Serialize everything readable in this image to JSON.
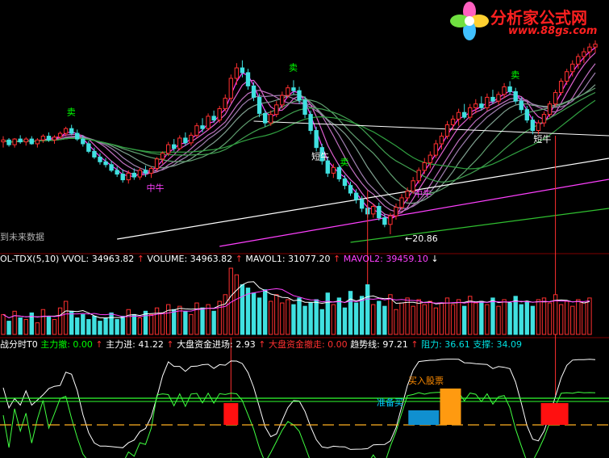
{
  "logo": {
    "name": "分析家公式网",
    "url": "www.88gs.com"
  },
  "price_panel": {
    "side_label": "到未来数据",
    "signals": [
      {
        "text": "卖",
        "color": "#00ff00"
      },
      {
        "text": "卖",
        "color": "#00ff00"
      },
      {
        "text": "卖",
        "color": "#00ff00"
      },
      {
        "text": "卖",
        "color": "#00ff00"
      },
      {
        "text": "短牛",
        "color": "#ffffff"
      },
      {
        "text": "短牛",
        "color": "#ffffff"
      },
      {
        "text": "中牛",
        "color": "#ff40ff"
      },
      {
        "text": "中牛",
        "color": "#ff40ff"
      }
    ],
    "low_marker": "←20.86"
  },
  "volume_panel": {
    "header": [
      {
        "text": "OL-TDX(5,10)",
        "color": "#ffffff"
      },
      {
        "text": "VVOL: 34963.82",
        "color": "#ffffff"
      },
      {
        "text": "↑",
        "color": "#ff3030"
      },
      {
        "text": "VOLUME: 34963.82",
        "color": "#ffffff"
      },
      {
        "text": "↑",
        "color": "#ff3030"
      },
      {
        "text": "MAVOL1: 31077.20",
        "color": "#ffffff"
      },
      {
        "text": "↑",
        "color": "#ff3030"
      },
      {
        "text": "MAVOL2: 39459.10",
        "color": "#ff40ff"
      },
      {
        "text": "↓",
        "color": "#ffffff"
      }
    ]
  },
  "indicator_panel": {
    "header": [
      {
        "text": "战分时T0",
        "color": "#ffffff"
      },
      {
        "text": "主力撤: 0.00",
        "color": "#00ff00"
      },
      {
        "text": "↑",
        "color": "#ff3030"
      },
      {
        "text": "主力进: 41.22",
        "color": "#ffffff"
      },
      {
        "text": "↑",
        "color": "#ff3030"
      },
      {
        "text": "大盘资金进场: 2.93",
        "color": "#ffffff"
      },
      {
        "text": "↑",
        "color": "#ff3030"
      },
      {
        "text": "大盘资金撤走: 0.00",
        "color": "#ff3030"
      },
      {
        "text": "趋势线: 97.21",
        "color": "#ffffff"
      },
      {
        "text": "↑",
        "color": "#ff3030"
      },
      {
        "text": "阻力: 36.61",
        "color": "#00e0e0"
      },
      {
        "text": "支撑: 34.09",
        "color": "#00e0e0"
      }
    ],
    "buy_label": "买入股票",
    "ready_label": "准备买"
  },
  "chart_data": {
    "type": "candlestick",
    "candles": [
      [
        30.6,
        31.2,
        30.0,
        30.8
      ],
      [
        30.8,
        31.0,
        30.1,
        30.3
      ],
      [
        30.3,
        31.0,
        30.0,
        30.9
      ],
      [
        30.9,
        31.3,
        30.4,
        30.6
      ],
      [
        30.6,
        31.1,
        30.2,
        30.9
      ],
      [
        30.9,
        31.2,
        30.3,
        30.4
      ],
      [
        30.4,
        31.0,
        30.0,
        30.8
      ],
      [
        30.8,
        31.4,
        30.5,
        31.2
      ],
      [
        31.2,
        31.6,
        30.6,
        30.8
      ],
      [
        30.8,
        31.3,
        30.4,
        31.1
      ],
      [
        31.1,
        31.7,
        30.9,
        31.5
      ],
      [
        31.5,
        32.2,
        31.2,
        32.0
      ],
      [
        32.0,
        32.4,
        31.3,
        31.5
      ],
      [
        31.5,
        31.9,
        30.7,
        30.9
      ],
      [
        30.9,
        31.3,
        30.1,
        30.4
      ],
      [
        30.4,
        30.7,
        29.4,
        29.6
      ],
      [
        29.6,
        30.0,
        28.8,
        29.0
      ],
      [
        29.0,
        29.4,
        28.2,
        28.5
      ],
      [
        28.5,
        28.9,
        27.9,
        28.2
      ],
      [
        28.2,
        28.6,
        27.4,
        27.6
      ],
      [
        27.6,
        28.0,
        26.9,
        27.2
      ],
      [
        27.2,
        27.7,
        26.3,
        26.6
      ],
      [
        26.6,
        27.6,
        26.2,
        27.3
      ],
      [
        27.3,
        27.8,
        26.6,
        26.9
      ],
      [
        26.9,
        27.9,
        26.6,
        27.6
      ],
      [
        27.6,
        28.1,
        26.9,
        27.3
      ],
      [
        27.3,
        28.0,
        26.8,
        27.8
      ],
      [
        27.8,
        29.0,
        27.5,
        28.8
      ],
      [
        28.8,
        29.6,
        28.3,
        29.4
      ],
      [
        29.4,
        30.6,
        29.1,
        30.3
      ],
      [
        30.3,
        30.9,
        29.6,
        29.9
      ],
      [
        29.9,
        31.3,
        29.7,
        31.0
      ],
      [
        31.0,
        31.6,
        30.2,
        30.5
      ],
      [
        30.5,
        31.6,
        30.2,
        31.3
      ],
      [
        31.3,
        32.6,
        31.0,
        32.3
      ],
      [
        32.3,
        33.1,
        31.6,
        32.0
      ],
      [
        32.0,
        33.6,
        31.8,
        33.3
      ],
      [
        33.3,
        33.9,
        32.6,
        32.9
      ],
      [
        32.9,
        34.4,
        32.6,
        34.1
      ],
      [
        34.1,
        35.6,
        33.8,
        35.2
      ],
      [
        35.2,
        37.7,
        34.7,
        37.3
      ],
      [
        37.3,
        38.9,
        36.6,
        38.4
      ],
      [
        38.4,
        39.2,
        37.4,
        37.9
      ],
      [
        37.9,
        38.3,
        36.1,
        36.5
      ],
      [
        36.5,
        36.9,
        34.9,
        35.3
      ],
      [
        35.3,
        35.7,
        33.2,
        33.6
      ],
      [
        33.6,
        34.0,
        32.2,
        32.6
      ],
      [
        32.6,
        33.9,
        32.3,
        33.5
      ],
      [
        33.5,
        34.9,
        33.2,
        34.5
      ],
      [
        34.5,
        35.9,
        34.1,
        35.5
      ],
      [
        35.5,
        36.6,
        35.2,
        36.3
      ],
      [
        36.3,
        37.1,
        35.6,
        36.0
      ],
      [
        36.0,
        36.4,
        34.6,
        35.0
      ],
      [
        35.0,
        35.4,
        33.1,
        33.5
      ],
      [
        33.5,
        33.9,
        31.4,
        31.8
      ],
      [
        31.8,
        32.2,
        29.6,
        30.0
      ],
      [
        30.0,
        30.4,
        28.2,
        28.6
      ],
      [
        28.6,
        29.0,
        26.9,
        27.3
      ],
      [
        27.3,
        28.3,
        26.8,
        27.9
      ],
      [
        27.9,
        28.2,
        26.4,
        26.7
      ],
      [
        26.7,
        27.1,
        25.6,
        26.0
      ],
      [
        26.0,
        26.4,
        24.9,
        25.2
      ],
      [
        25.2,
        25.6,
        24.1,
        24.5
      ],
      [
        24.5,
        24.9,
        23.2,
        23.6
      ],
      [
        23.6,
        24.0,
        22.6,
        23.0
      ],
      [
        23.0,
        24.1,
        22.6,
        23.8
      ],
      [
        23.8,
        24.2,
        22.3,
        22.6
      ],
      [
        22.6,
        23.0,
        21.6,
        21.9
      ],
      [
        21.9,
        23.1,
        20.86,
        22.8
      ],
      [
        22.8,
        24.1,
        22.4,
        23.7
      ],
      [
        23.7,
        25.1,
        23.4,
        24.7
      ],
      [
        24.7,
        25.8,
        24.3,
        25.4
      ],
      [
        25.4,
        26.9,
        25.1,
        26.5
      ],
      [
        26.5,
        27.9,
        26.2,
        27.6
      ],
      [
        27.6,
        28.9,
        27.2,
        28.4
      ],
      [
        28.4,
        29.6,
        27.8,
        29.2
      ],
      [
        29.2,
        30.8,
        28.9,
        30.4
      ],
      [
        30.4,
        31.6,
        29.8,
        31.2
      ],
      [
        31.2,
        32.8,
        30.9,
        32.4
      ],
      [
        32.4,
        33.4,
        31.8,
        33.0
      ],
      [
        33.0,
        34.1,
        32.3,
        33.7
      ],
      [
        33.7,
        34.6,
        33.0,
        33.2
      ],
      [
        33.2,
        34.6,
        32.9,
        34.2
      ],
      [
        34.2,
        35.1,
        33.6,
        34.6
      ],
      [
        34.6,
        35.4,
        33.9,
        34.2
      ],
      [
        34.2,
        35.7,
        33.9,
        35.3
      ],
      [
        35.3,
        36.1,
        34.6,
        34.9
      ],
      [
        34.9,
        35.9,
        34.5,
        35.6
      ],
      [
        35.6,
        36.8,
        35.2,
        36.4
      ],
      [
        36.4,
        37.0,
        35.6,
        35.9
      ],
      [
        35.9,
        36.3,
        34.6,
        34.9
      ],
      [
        34.9,
        35.3,
        33.6,
        34.0
      ],
      [
        34.0,
        34.4,
        32.6,
        32.9
      ],
      [
        32.9,
        33.3,
        31.4,
        31.8
      ],
      [
        31.8,
        32.9,
        31.4,
        32.6
      ],
      [
        32.6,
        33.8,
        32.2,
        33.5
      ],
      [
        33.5,
        34.9,
        33.2,
        34.6
      ],
      [
        34.6,
        36.1,
        34.3,
        35.8
      ],
      [
        35.8,
        37.3,
        35.5,
        37.0
      ],
      [
        37.0,
        38.3,
        36.6,
        38.0
      ],
      [
        38.0,
        39.2,
        37.5,
        38.8
      ],
      [
        38.8,
        39.9,
        38.3,
        39.6
      ],
      [
        39.6,
        40.5,
        38.9,
        40.1
      ],
      [
        40.1,
        41.0,
        39.5,
        40.6
      ],
      [
        40.6,
        41.3,
        40.0,
        40.9
      ]
    ],
    "volume": [
      12,
      8,
      14,
      10,
      9,
      13,
      7,
      15,
      11,
      9,
      16,
      20,
      14,
      10,
      12,
      9,
      11,
      8,
      10,
      13,
      9,
      11,
      15,
      12,
      10,
      14,
      12,
      16,
      13,
      18,
      15,
      17,
      14,
      12,
      19,
      16,
      18,
      14,
      20,
      24,
      40,
      36,
      30,
      28,
      25,
      22,
      27,
      20,
      24,
      19,
      21,
      18,
      22,
      17,
      19,
      21,
      15,
      25,
      18,
      22,
      16,
      26,
      19,
      23,
      30,
      18,
      20,
      17,
      24,
      15,
      19,
      22,
      17,
      21,
      18,
      20,
      16,
      19,
      22,
      18,
      21,
      17,
      23,
      19,
      20,
      18,
      22,
      17,
      21,
      19,
      23,
      18,
      20,
      17,
      21,
      22,
      19,
      24,
      18,
      20,
      17,
      21,
      19,
      22
    ],
    "x": [],
    "title": "",
    "xlabel": "",
    "ylabel": "",
    "panels": [
      "price",
      "volume",
      "indicator"
    ],
    "grid": false
  }
}
